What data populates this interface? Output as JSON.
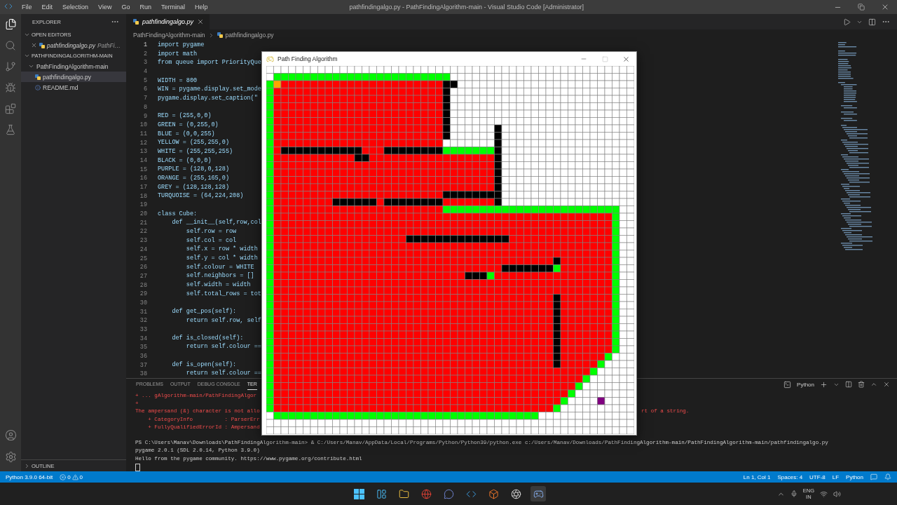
{
  "window": {
    "title": "pathfindingalgo.py - PathFindingAlgorithm-main - Visual Studio Code [Administrator]"
  },
  "menu": [
    "File",
    "Edit",
    "Selection",
    "View",
    "Go",
    "Run",
    "Terminal",
    "Help"
  ],
  "explorer": {
    "title": "EXPLORER",
    "sections": [
      {
        "label": "OPEN EDITORS",
        "expanded": true,
        "items": [
          {
            "name": "pathfindingalgo.py",
            "detail": "PathFi…",
            "selected": false
          }
        ]
      },
      {
        "label": "PATHFINDINGALGORITHM-MAIN",
        "expanded": true,
        "children": [
          {
            "name": "PathFindingAlgorithm-main",
            "kind": "folder",
            "expanded": true,
            "selected": false,
            "children": [
              {
                "name": "pathfindingalgo.py",
                "kind": "python",
                "selected": true
              },
              {
                "name": "README.md",
                "kind": "info",
                "selected": false
              }
            ]
          }
        ]
      }
    ],
    "outline": {
      "label": "OUTLINE",
      "expanded": false
    }
  },
  "editor": {
    "tabs": [
      {
        "label": "pathfindingalgo.py",
        "selected": true
      }
    ],
    "breadcrumb": [
      "PathFindingAlgorithm-main",
      "pathfindingalgo.py"
    ],
    "lines": [
      {
        "n": "1",
        "text": "import pygame",
        "current": true
      },
      {
        "n": "2",
        "text": "import math",
        "current": false
      },
      {
        "n": "3",
        "text": "from queue import PriorityQue",
        "current": false
      },
      {
        "n": "4",
        "current": false
      },
      {
        "n": "5",
        "text": "WIDTH = 800",
        "current": false
      },
      {
        "n": "6",
        "text": "WIN = pygame.display.set_mode",
        "current": false
      },
      {
        "n": "7",
        "text": "pygame.display.set_caption(\"",
        "current": false
      },
      {
        "n": "8",
        "current": false
      },
      {
        "n": "9",
        "text": "RED = (255,0,0)",
        "current": false
      },
      {
        "n": "10",
        "text": "GREEN = (0,255,0)",
        "current": false
      },
      {
        "n": "11",
        "text": "BLUE = (0,0,255)",
        "current": false
      },
      {
        "n": "12",
        "text": "YELLOW = (255,255,0)",
        "current": false
      },
      {
        "n": "13",
        "text": "WHITE = (255,255,255)",
        "current": false
      },
      {
        "n": "14",
        "text": "BLACK = (0,0,0)",
        "current": false
      },
      {
        "n": "15",
        "text": "PURPLE = (128,0,128)",
        "current": false
      },
      {
        "n": "16",
        "text": "ORANGE = (255,165,0)",
        "current": false
      },
      {
        "n": "17",
        "text": "GREY = (128,128,128)",
        "current": false
      },
      {
        "n": "18",
        "text": "TURQUOISE = (64,224,208)",
        "current": false
      },
      {
        "n": "19",
        "current": false
      },
      {
        "n": "20",
        "text": "class Cube:",
        "current": false
      },
      {
        "n": "21",
        "text": "    def __init__(self,row,col",
        "current": false
      },
      {
        "n": "22",
        "text": "        self.row = row",
        "current": false
      },
      {
        "n": "23",
        "text": "        self.col = col",
        "current": false
      },
      {
        "n": "24",
        "text": "        self.x = row * width",
        "current": false
      },
      {
        "n": "25",
        "text": "        self.y = col * width",
        "current": false
      },
      {
        "n": "26",
        "text": "        self.colour = WHITE",
        "current": false
      },
      {
        "n": "27",
        "text": "        self.neighbors = []",
        "current": false
      },
      {
        "n": "28",
        "text": "        self.width = width",
        "current": false
      },
      {
        "n": "29",
        "text": "        self.total_rows = tot",
        "current": false
      },
      {
        "n": "30",
        "current": false
      },
      {
        "n": "31",
        "text": "    def get_pos(self):",
        "current": false
      },
      {
        "n": "32",
        "text": "        return self.row, self",
        "current": false
      },
      {
        "n": "33",
        "current": false
      },
      {
        "n": "34",
        "text": "    def is_closed(self):",
        "current": false
      },
      {
        "n": "35",
        "text": "        return self.colour ==",
        "current": false
      },
      {
        "n": "36",
        "current": false
      },
      {
        "n": "37",
        "text": "    def is_open(self):",
        "current": false
      },
      {
        "n": "38",
        "text": "        return self.colour ==",
        "current": false
      }
    ]
  },
  "panel": {
    "tabs": [
      {
        "label": "PROBLEMS",
        "selected": false
      },
      {
        "label": "OUTPUT",
        "selected": false
      },
      {
        "label": "DEBUG CONSOLE",
        "selected": false
      },
      {
        "label": "TER",
        "selected": true
      }
    ],
    "terminal_name": "Python",
    "lines": [
      {
        "kind": "error",
        "text": "+ ... gAlgorithm-main/PathFindingAlgor"
      },
      {
        "kind": "error",
        "text": "+"
      },
      {
        "kind": "error",
        "text": "The ampersand (&) character is not allo",
        "tail": "rt of a string."
      },
      {
        "kind": "error",
        "text": "    + CategoryInfo          : ParserErr"
      },
      {
        "kind": "error",
        "text": "    + FullyQualifiedErrorId : Ampersand"
      },
      {
        "kind": "blank"
      },
      {
        "kind": "output",
        "text": "PS C:\\Users\\Manav\\Downloads\\PathFindingAlgorithm-main> & C:/Users/Manav/AppData/Local/Programs/Python/Python39/python.exe c:/Users/Manav/Downloads/PathFindingAlgorithm-main/PathFindingAlgorithm-main/pathfindingalgo.py"
      },
      {
        "kind": "output",
        "text": "pygame 2.0.1 (SDL 2.0.14, Python 3.9.0)"
      },
      {
        "kind": "output",
        "text": "Hello from the pygame community. https://www.pygame.org/contribute.html"
      },
      {
        "kind": "cursor"
      }
    ]
  },
  "game_window": {
    "title": "Path Finding Algorithm"
  },
  "status_bar": {
    "interpreter": "Python 3.9.0 64-bit",
    "errors": "0",
    "warnings": "0",
    "right": [
      "Ln 1, Col 1",
      "Spaces: 4",
      "UTF-8",
      "LF",
      "Python"
    ]
  },
  "taskbar": {
    "language": "ENG",
    "region": "IN"
  }
}
